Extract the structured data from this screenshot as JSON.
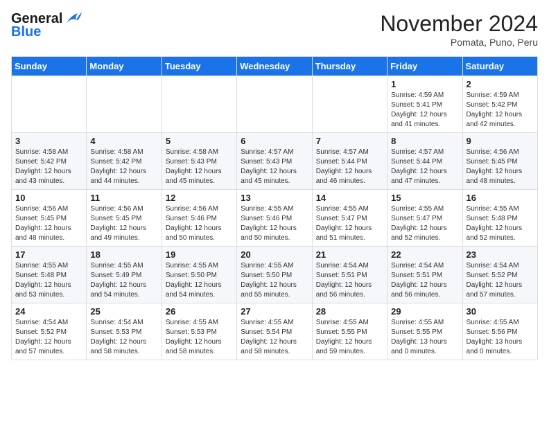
{
  "header": {
    "logo_general": "General",
    "logo_blue": "Blue",
    "month_title": "November 2024",
    "location": "Pomata, Puno, Peru"
  },
  "weekdays": [
    "Sunday",
    "Monday",
    "Tuesday",
    "Wednesday",
    "Thursday",
    "Friday",
    "Saturday"
  ],
  "weeks": [
    [
      {
        "day": "",
        "info": ""
      },
      {
        "day": "",
        "info": ""
      },
      {
        "day": "",
        "info": ""
      },
      {
        "day": "",
        "info": ""
      },
      {
        "day": "",
        "info": ""
      },
      {
        "day": "1",
        "info": "Sunrise: 4:59 AM\nSunset: 5:41 PM\nDaylight: 12 hours and 41 minutes."
      },
      {
        "day": "2",
        "info": "Sunrise: 4:59 AM\nSunset: 5:42 PM\nDaylight: 12 hours and 42 minutes."
      }
    ],
    [
      {
        "day": "3",
        "info": "Sunrise: 4:58 AM\nSunset: 5:42 PM\nDaylight: 12 hours and 43 minutes."
      },
      {
        "day": "4",
        "info": "Sunrise: 4:58 AM\nSunset: 5:42 PM\nDaylight: 12 hours and 44 minutes."
      },
      {
        "day": "5",
        "info": "Sunrise: 4:58 AM\nSunset: 5:43 PM\nDaylight: 12 hours and 45 minutes."
      },
      {
        "day": "6",
        "info": "Sunrise: 4:57 AM\nSunset: 5:43 PM\nDaylight: 12 hours and 45 minutes."
      },
      {
        "day": "7",
        "info": "Sunrise: 4:57 AM\nSunset: 5:44 PM\nDaylight: 12 hours and 46 minutes."
      },
      {
        "day": "8",
        "info": "Sunrise: 4:57 AM\nSunset: 5:44 PM\nDaylight: 12 hours and 47 minutes."
      },
      {
        "day": "9",
        "info": "Sunrise: 4:56 AM\nSunset: 5:45 PM\nDaylight: 12 hours and 48 minutes."
      }
    ],
    [
      {
        "day": "10",
        "info": "Sunrise: 4:56 AM\nSunset: 5:45 PM\nDaylight: 12 hours and 48 minutes."
      },
      {
        "day": "11",
        "info": "Sunrise: 4:56 AM\nSunset: 5:45 PM\nDaylight: 12 hours and 49 minutes."
      },
      {
        "day": "12",
        "info": "Sunrise: 4:56 AM\nSunset: 5:46 PM\nDaylight: 12 hours and 50 minutes."
      },
      {
        "day": "13",
        "info": "Sunrise: 4:55 AM\nSunset: 5:46 PM\nDaylight: 12 hours and 50 minutes."
      },
      {
        "day": "14",
        "info": "Sunrise: 4:55 AM\nSunset: 5:47 PM\nDaylight: 12 hours and 51 minutes."
      },
      {
        "day": "15",
        "info": "Sunrise: 4:55 AM\nSunset: 5:47 PM\nDaylight: 12 hours and 52 minutes."
      },
      {
        "day": "16",
        "info": "Sunrise: 4:55 AM\nSunset: 5:48 PM\nDaylight: 12 hours and 52 minutes."
      }
    ],
    [
      {
        "day": "17",
        "info": "Sunrise: 4:55 AM\nSunset: 5:48 PM\nDaylight: 12 hours and 53 minutes."
      },
      {
        "day": "18",
        "info": "Sunrise: 4:55 AM\nSunset: 5:49 PM\nDaylight: 12 hours and 54 minutes."
      },
      {
        "day": "19",
        "info": "Sunrise: 4:55 AM\nSunset: 5:50 PM\nDaylight: 12 hours and 54 minutes."
      },
      {
        "day": "20",
        "info": "Sunrise: 4:55 AM\nSunset: 5:50 PM\nDaylight: 12 hours and 55 minutes."
      },
      {
        "day": "21",
        "info": "Sunrise: 4:54 AM\nSunset: 5:51 PM\nDaylight: 12 hours and 56 minutes."
      },
      {
        "day": "22",
        "info": "Sunrise: 4:54 AM\nSunset: 5:51 PM\nDaylight: 12 hours and 56 minutes."
      },
      {
        "day": "23",
        "info": "Sunrise: 4:54 AM\nSunset: 5:52 PM\nDaylight: 12 hours and 57 minutes."
      }
    ],
    [
      {
        "day": "24",
        "info": "Sunrise: 4:54 AM\nSunset: 5:52 PM\nDaylight: 12 hours and 57 minutes."
      },
      {
        "day": "25",
        "info": "Sunrise: 4:54 AM\nSunset: 5:53 PM\nDaylight: 12 hours and 58 minutes."
      },
      {
        "day": "26",
        "info": "Sunrise: 4:55 AM\nSunset: 5:53 PM\nDaylight: 12 hours and 58 minutes."
      },
      {
        "day": "27",
        "info": "Sunrise: 4:55 AM\nSunset: 5:54 PM\nDaylight: 12 hours and 58 minutes."
      },
      {
        "day": "28",
        "info": "Sunrise: 4:55 AM\nSunset: 5:55 PM\nDaylight: 12 hours and 59 minutes."
      },
      {
        "day": "29",
        "info": "Sunrise: 4:55 AM\nSunset: 5:55 PM\nDaylight: 13 hours and 0 minutes."
      },
      {
        "day": "30",
        "info": "Sunrise: 4:55 AM\nSunset: 5:56 PM\nDaylight: 13 hours and 0 minutes."
      }
    ]
  ]
}
